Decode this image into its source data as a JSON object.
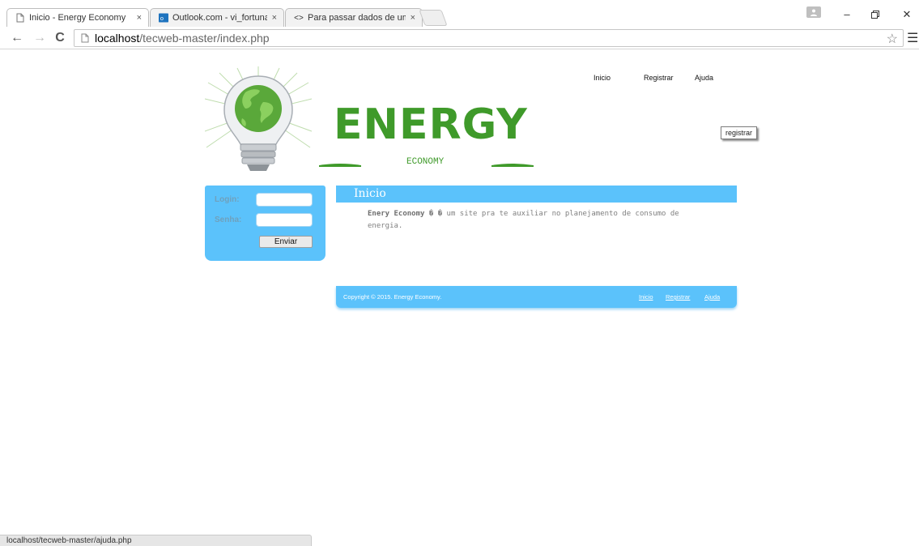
{
  "browser": {
    "tabs": [
      {
        "title": "Inicio - Energy Economy",
        "close": "×"
      },
      {
        "title": "Outlook.com - vi_fortunat",
        "close": "×"
      },
      {
        "title": "Para passar dados de um",
        "close": "×"
      }
    ],
    "url_host": "localhost",
    "url_path": "/tecweb-master/index.php",
    "status_url": "localhost/tecweb-master/ajuda.php"
  },
  "header": {
    "brand": "ENERGY",
    "brand_sub": "ECONOMY",
    "nav": [
      "Inicio",
      "Registrar",
      "Ajuda"
    ],
    "register_button": "registrar"
  },
  "login": {
    "login_label": "Login:",
    "password_label": "Senha:",
    "submit": "Enviar"
  },
  "content": {
    "title": "Inicio",
    "brand_name": "Enery Economy",
    "text": " � � um site pra te auxiliar no planejamento de consumo de energia."
  },
  "footer": {
    "copyright": "Copyright © 2015. Energy Economy.",
    "links": [
      "Inicio",
      "Registrar",
      "Ajuda"
    ]
  },
  "colors": {
    "accent_blue": "#5bc2fb",
    "brand_green": "#3f9a2a"
  },
  "icons": [
    "page-icon",
    "outlook-icon",
    "code-icon",
    "back-arrow-icon",
    "forward-arrow-icon",
    "reload-icon",
    "star-icon",
    "menu-icon",
    "user-icon",
    "minimize-icon",
    "restore-icon",
    "close-icon"
  ]
}
